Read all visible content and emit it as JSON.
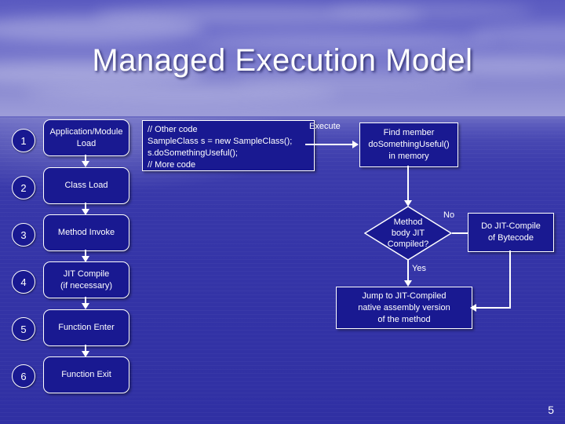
{
  "slide": {
    "title": "Managed Execution Model",
    "page_number": "5",
    "accent_box_color": "#191991",
    "outline_color": "#ffffff",
    "background_top_color": "#5a5ac0",
    "background_water_color": "#3434a7"
  },
  "steps": [
    {
      "num": "1",
      "label": "Application/Module\nLoad"
    },
    {
      "num": "2",
      "label": "Class Load"
    },
    {
      "num": "3",
      "label": "Method Invoke"
    },
    {
      "num": "4",
      "label": "JIT Compile\n(if necessary)"
    },
    {
      "num": "5",
      "label": "Function Enter"
    },
    {
      "num": "6",
      "label": "Function Exit"
    }
  ],
  "code_block": {
    "lines": [
      "// Other code",
      "SampleClass s = new SampleClass();",
      "s.doSomethingUseful();",
      "// More code"
    ],
    "text": "// Other code\nSampleClass s = new SampleClass();\ns.doSomethingUseful();\n// More code"
  },
  "flow": {
    "execute_label": "Execute",
    "find_member": "Find member\ndoSomethingUseful()\nin memory",
    "decision": "Method\nbody JIT\nCompiled?",
    "decision_no_label": "No",
    "decision_yes_label": "Yes",
    "jit_compile": "Do JIT-Compile\nof Bytecode",
    "jump": "Jump to JIT-Compiled\nnative assembly version\nof the method"
  }
}
